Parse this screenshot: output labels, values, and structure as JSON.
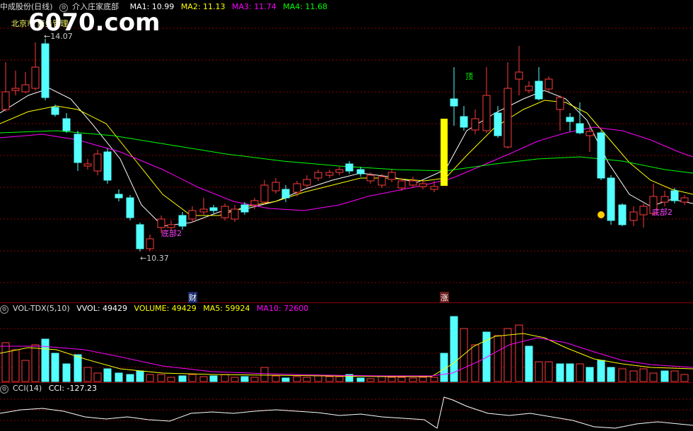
{
  "header": {
    "stock": "中成股份(日线)",
    "indicator": "介入庄家底部",
    "ma1": "MA1: 10.99",
    "ma2": "MA2: 11.13",
    "ma3": "MA3: 11.74",
    "ma4": "MA4: 11.68",
    "note": "北京市 商务管理"
  },
  "watermark": "6070.com",
  "annotations": {
    "high": "14.07",
    "low": "10.37",
    "top": "顶",
    "bottom1": "底部2",
    "bottom2": "底部2",
    "cai": "财",
    "zhang": "涨"
  },
  "vol_header": {
    "name": "VOL-TDX(5,10)",
    "vvol": "VVOL: 49429",
    "volume": "VOLUME: 49429",
    "ma5": "MA5: 59924",
    "ma10": "MA10: 72600"
  },
  "cci_header": {
    "name": "CCI(14)",
    "cci": "CCI: -127.23"
  },
  "colors": {
    "up": "#ff3b3b",
    "down": "#54ffff",
    "ma1": "#ffffff",
    "ma2": "#ffff00",
    "ma3": "#ff00ff",
    "ma4": "#00ff00",
    "grid": "#8b0000"
  }
}
